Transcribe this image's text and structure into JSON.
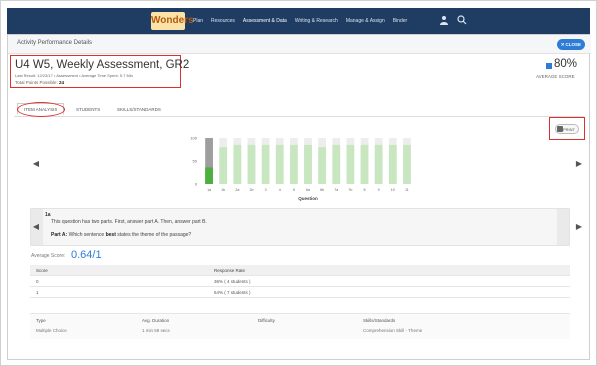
{
  "nav": {
    "logo": "Wonders",
    "links": [
      "Plan",
      "Resources",
      "Assessment & Data",
      "Writing & Research",
      "Manage & Assign",
      "Binder"
    ],
    "active_index": 2,
    "icons": [
      "user-icon",
      "search-icon"
    ]
  },
  "panel": {
    "title": "Activity Performance Details",
    "close_label": "CLOSE"
  },
  "assessment": {
    "title": "U4 W5, Weekly Assessment, GR2",
    "meta": "Last Result: 12/23/17  • Assessment  • Average Time Spent: 5.7 Min",
    "points_label": "Total Points Possible:",
    "points_value": "24",
    "average_score": "80%",
    "average_score_label": "AVERAGE SCORE"
  },
  "tabs": [
    "ITEM ANALYSIS",
    "STUDENTS",
    "SKILLS/STANDARDS"
  ],
  "print_label": "PRINT",
  "chart_data": {
    "type": "bar",
    "xlabel": "Question",
    "ylim": [
      0,
      100
    ],
    "yticks": [
      0,
      50,
      100
    ],
    "categories": [
      "1a",
      "1b",
      "2a",
      "2b",
      "3",
      "4",
      "5",
      "6a",
      "6b",
      "7a",
      "7b",
      "8",
      "9",
      "10",
      "11"
    ],
    "series": [
      {
        "values": [
          36,
          80,
          85,
          85,
          85,
          85,
          85,
          85,
          80,
          85,
          85,
          85,
          85,
          85,
          85
        ]
      }
    ],
    "colors": {
      "correct": "#4caf3e",
      "correct_light": "#c8e6c0",
      "remainder": "#ededed",
      "first_remainder": "#9e9e9e"
    }
  },
  "question": {
    "number": "1a",
    "text": "This question has two parts. First, answer part A. Then, answer part B.",
    "part_label": "Part A:",
    "part_text_before": "Which sentence",
    "part_bold": "best",
    "part_text_after": "states the theme of the passage?"
  },
  "average": {
    "label": "Average Score:",
    "value": "0.64/1"
  },
  "response_table": {
    "headers": [
      "Score",
      "Response Rate"
    ],
    "rows": [
      [
        "0",
        "36% ( 4 students )"
      ],
      [
        "1",
        "64% ( 7 students )"
      ]
    ]
  },
  "details": {
    "headers": [
      "Type",
      "Avg. Duration",
      "Difficulty",
      "Skills/Standards"
    ],
    "values": [
      "Multiple Choice",
      "1 min 59 secs",
      "",
      "Comprehension Skill - Theme"
    ]
  }
}
